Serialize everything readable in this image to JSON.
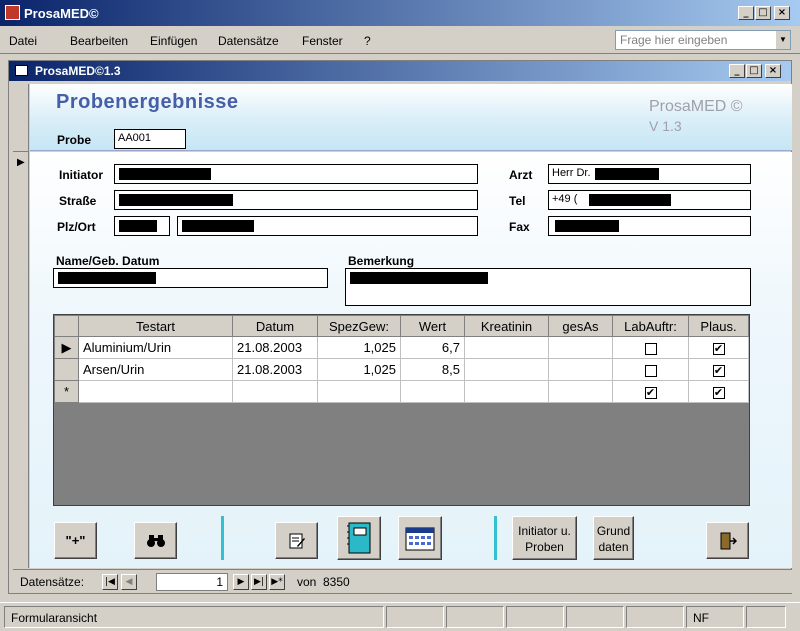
{
  "app": {
    "title": "ProsaMED©"
  },
  "menu": {
    "items": [
      "Datei",
      "Bearbeiten",
      "Einfügen",
      "Datensätze",
      "Fenster",
      "?"
    ],
    "help_placeholder": "Frage hier eingeben"
  },
  "form_window": {
    "title": "ProsaMED©1.3"
  },
  "header": {
    "title": "Probenergebnisse",
    "brand": "ProsaMED ©",
    "version": "V 1.3",
    "probe_label": "Probe",
    "probe_value": "AA001"
  },
  "fields": {
    "initiator_label": "Initiator",
    "strasse_label": "Straße",
    "plz_label": "Plz/Ort",
    "arzt_label": "Arzt",
    "arzt_value": "Herr Dr.",
    "tel_label": "Tel",
    "tel_value": "+49 (",
    "fax_label": "Fax",
    "name_label": "Name/Geb. Datum",
    "bemerkung_label": "Bemerkung"
  },
  "grid": {
    "columns": [
      "Testart",
      "Datum",
      "SpezGew:",
      "Wert",
      "Kreatinin",
      "gesAs",
      "LabAuftr:",
      "Plaus."
    ],
    "rows": [
      {
        "testart": "Aluminium/Urin",
        "datum": "21.08.2003",
        "spezgew": "1,025",
        "wert": "6,7",
        "kreatinin": "",
        "gesas": "",
        "labauftr": false,
        "plaus": true
      },
      {
        "testart": "Arsen/Urin",
        "datum": "21.08.2003",
        "spezgew": "1,025",
        "wert": "8,5",
        "kreatinin": "",
        "gesas": "",
        "labauftr": false,
        "plaus": true
      }
    ],
    "new_row": {
      "labauftr": true,
      "plaus": true
    }
  },
  "buttons": {
    "add": "\"+\"",
    "initiator_proben": "Initiator u. Proben",
    "grunddaten": "Grund daten"
  },
  "nav": {
    "label": "Datensätze:",
    "current": "1",
    "of": "von",
    "total": "8350"
  },
  "status": {
    "text": "Formularansicht",
    "mode": "NF"
  }
}
